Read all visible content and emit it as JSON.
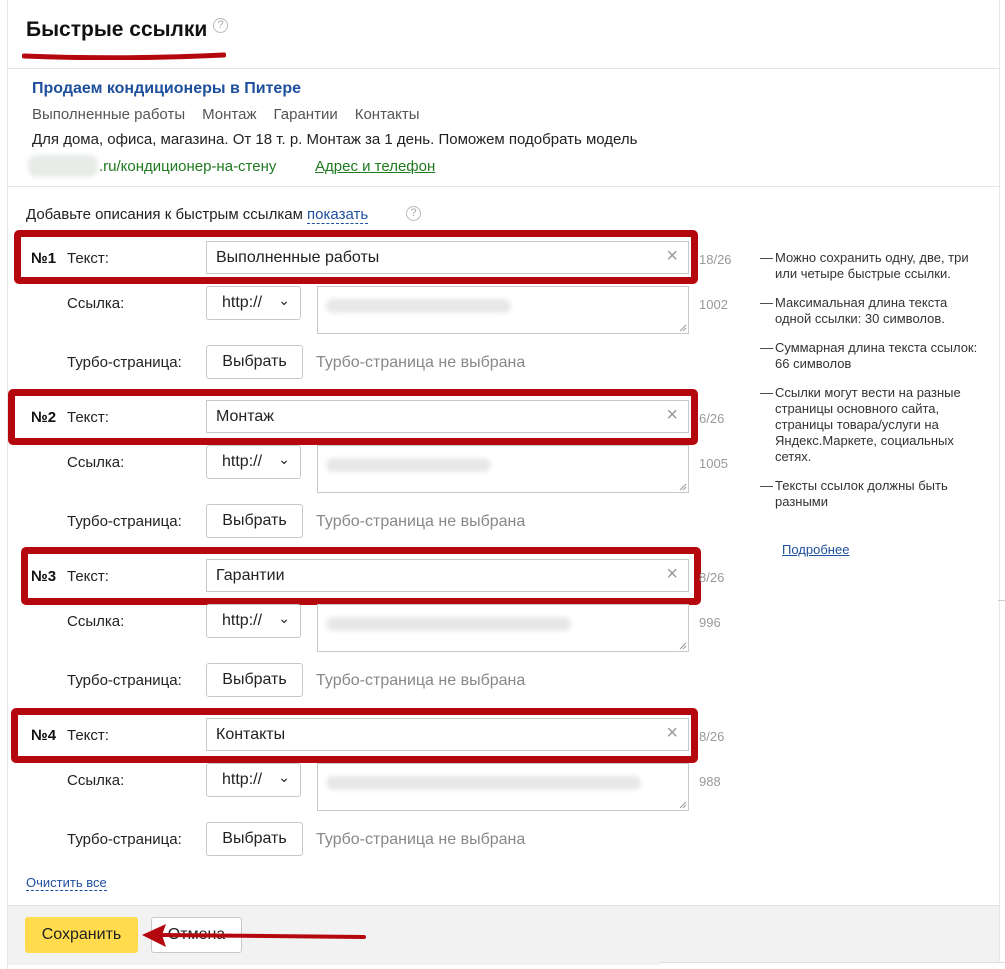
{
  "header": {
    "title": "Быстрые ссылки",
    "help": "?"
  },
  "preview": {
    "title": "Продаем кондиционеры в Питере",
    "links": [
      "Выполненные работы",
      "Монтаж",
      "Гарантии",
      "Контакты"
    ],
    "description": "Для дома, офиса, магазина. От 18 т. р. Монтаж за 1 день. Поможем подобрать модель",
    "url": ".ru/кондиционер-на-стену",
    "address_link": "Адрес и телефон"
  },
  "descriptions": {
    "text": "Добавьте описания к быстрым ссылкам ",
    "show_link": "показать",
    "help": "?"
  },
  "labels": {
    "text": "Текст:",
    "link": "Ссылка:",
    "turbo": "Турбо-страница:",
    "choose": "Выбрать",
    "turbo_none": "Турбо-страница не выбрана",
    "protocol": "http://",
    "clear_icon": "×",
    "chevron": "❯"
  },
  "links": [
    {
      "number": "№1",
      "text": "Выполненные работы",
      "text_counter": "18/26",
      "url_counter": "1002"
    },
    {
      "number": "№2",
      "text": "Монтаж",
      "text_counter": "6/26",
      "url_counter": "1005"
    },
    {
      "number": "№3",
      "text": "Гарантии",
      "text_counter": "8/26",
      "url_counter": "996"
    },
    {
      "number": "№4",
      "text": "Контакты",
      "text_counter": "8/26",
      "url_counter": "988"
    }
  ],
  "tips": {
    "items": [
      "Можно сохранить одну, две, три или четыре быстрые ссылки.",
      "Максимальная длина текста одной ссылки: 30 символов.",
      "Суммарная длина текста ссылок: 66 символов",
      "Ссылки могут вести на разные страницы основного сайта, страницы товара/услуги на Яндекс.Маркете, социальных сетях.",
      "Тексты ссылок должны быть разными"
    ],
    "more": "Подробнее"
  },
  "footer": {
    "clear_all": "Очистить все",
    "save": "Сохранить",
    "cancel": "Отмена"
  },
  "colors": {
    "accent": "#ffdb4d",
    "highlight": "#b5080e",
    "link": "#1e4f9c",
    "url_green": "#1f7a1f"
  }
}
